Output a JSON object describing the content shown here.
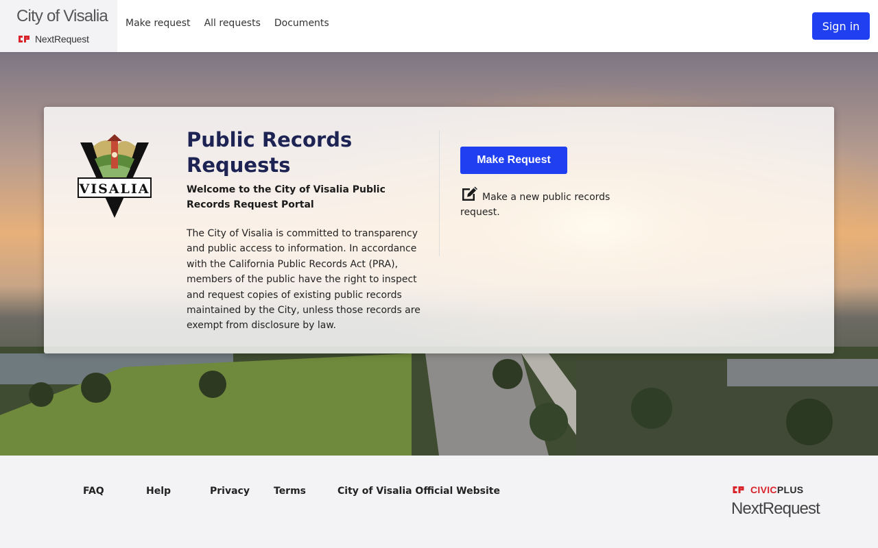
{
  "header": {
    "brand_title": "City of Visalia",
    "brand_sub": "NextRequest",
    "nav": [
      {
        "label": "Make request"
      },
      {
        "label": "All requests"
      },
      {
        "label": "Documents"
      }
    ],
    "sign_in_label": "Sign in"
  },
  "hero": {
    "logo_text": "VISALIA",
    "title": "Public Records Requests",
    "subtitle": "Welcome to the City of Visalia Public Records Request Portal",
    "body": "The City of Visalia is committed to transparency and public access to information. In accordance with the California Public Records Act (PRA), members of the public have the right to inspect and request copies of existing public records maintained by the City, unless those records are exempt from disclosure by law.",
    "make_request_label": "Make Request",
    "make_request_desc": "Make a new public records request."
  },
  "footer": {
    "links": [
      {
        "label": "FAQ"
      },
      {
        "label": "Help"
      },
      {
        "label": "Privacy"
      },
      {
        "label": "Terms"
      },
      {
        "label": "City of Visalia Official Website"
      }
    ],
    "civic_a": "CIVIC",
    "civic_b": "PLUS",
    "nextrequest": "NextRequest"
  },
  "colors": {
    "accent": "#1f3ff0",
    "title": "#1d2454",
    "civicplus_red": "#d8232a"
  },
  "icons": [
    "civicplus-logo-icon",
    "visalia-seal-icon",
    "edit-icon"
  ]
}
